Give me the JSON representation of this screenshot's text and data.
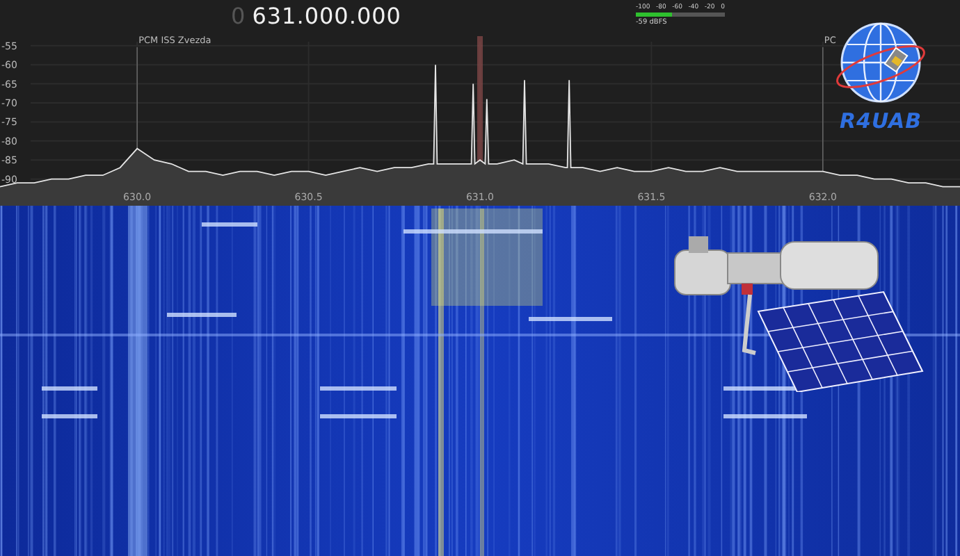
{
  "frequency": {
    "leading_digit": "0",
    "value": "631.000.000"
  },
  "level_meter": {
    "scale": [
      "-100",
      "-80",
      "-60",
      "-40",
      "-20",
      "0"
    ],
    "level": 0.4,
    "reading": "-59 dBFS"
  },
  "spectrum": {
    "markers": [
      {
        "label": "PCM ISS Zvezda"
      },
      {
        "label": "PC"
      }
    ],
    "chart_data": {
      "type": "line",
      "grid": true,
      "xlim": [
        629.6,
        632.4
      ],
      "ylim": [
        -97,
        -43
      ],
      "xticks": [
        {
          "value": 630,
          "label": "630.0"
        },
        {
          "value": 630.5,
          "label": "630.5"
        },
        {
          "value": 631,
          "label": "631.0"
        },
        {
          "value": 631.5,
          "label": "631.5"
        },
        {
          "value": 632,
          "label": "632.0"
        }
      ],
      "yticks": [
        -55,
        -60,
        -65,
        -70,
        -75,
        -80,
        -85,
        -90
      ],
      "x": [
        629.6,
        629.65,
        629.7,
        629.75,
        629.8,
        629.85,
        629.9,
        629.95,
        630.0,
        630.05,
        630.1,
        630.15,
        630.2,
        630.25,
        630.3,
        630.35,
        630.4,
        630.45,
        630.5,
        630.55,
        630.6,
        630.65,
        630.7,
        630.75,
        630.8,
        630.85,
        630.865,
        630.87,
        630.875,
        630.9,
        630.95,
        630.975,
        630.98,
        630.985,
        631.0,
        631.015,
        631.02,
        631.025,
        631.05,
        631.1,
        631.125,
        631.13,
        631.135,
        631.15,
        631.2,
        631.25,
        631.255,
        631.26,
        631.265,
        631.3,
        631.35,
        631.4,
        631.45,
        631.5,
        631.55,
        631.6,
        631.65,
        631.7,
        631.75,
        631.8,
        631.85,
        631.9,
        631.95,
        632.0,
        632.05,
        632.1,
        632.15,
        632.2,
        632.25,
        632.3,
        632.35,
        632.4
      ],
      "series": [
        {
          "color": "#e6e6e6",
          "values": [
            -92,
            -91,
            -91,
            -90,
            -90,
            -89,
            -89,
            -87,
            -82,
            -85,
            -86,
            -88,
            -88,
            -89,
            -88,
            -88,
            -89,
            -88,
            -88,
            -89,
            -88,
            -87,
            -88,
            -87,
            -87,
            -86,
            -86,
            -60,
            -86,
            -86,
            -86,
            -86,
            -65,
            -86,
            -85,
            -86,
            -69,
            -86,
            -86,
            -85,
            -86,
            -64,
            -86,
            -86,
            -86,
            -87,
            -87,
            -64,
            -87,
            -87,
            -88,
            -87,
            -88,
            -88,
            -87,
            -88,
            -88,
            -87,
            -88,
            -88,
            -88,
            -88,
            -88,
            -88,
            -89,
            -89,
            -90,
            -90,
            -91,
            -91,
            -92,
            -92
          ]
        }
      ]
    }
  },
  "logo": {
    "text": "R4UAB"
  }
}
